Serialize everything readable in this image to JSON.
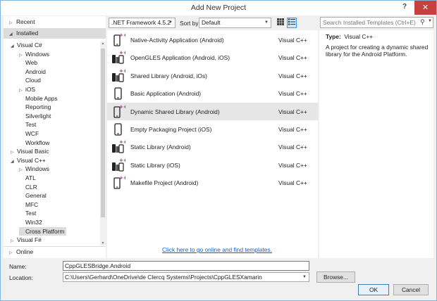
{
  "window": {
    "title": "Add New Project",
    "help_label": "?",
    "close_label": "✕"
  },
  "left": {
    "recent": "Recent",
    "installed": "Installed",
    "online": "Online",
    "tree": [
      {
        "label": "Visual C#",
        "arrow": "◢",
        "indent": 0
      },
      {
        "label": "Windows",
        "arrow": "▷",
        "indent": 1
      },
      {
        "label": "Web",
        "arrow": "",
        "indent": 1
      },
      {
        "label": "Android",
        "arrow": "",
        "indent": 1
      },
      {
        "label": "Cloud",
        "arrow": "",
        "indent": 1
      },
      {
        "label": "iOS",
        "arrow": "▷",
        "indent": 1
      },
      {
        "label": "Mobile Apps",
        "arrow": "",
        "indent": 1
      },
      {
        "label": "Reporting",
        "arrow": "",
        "indent": 1
      },
      {
        "label": "Silverlight",
        "arrow": "",
        "indent": 1
      },
      {
        "label": "Test",
        "arrow": "",
        "indent": 1
      },
      {
        "label": "WCF",
        "arrow": "",
        "indent": 1
      },
      {
        "label": "Workflow",
        "arrow": "",
        "indent": 1
      },
      {
        "label": "Visual Basic",
        "arrow": "▷",
        "indent": 0
      },
      {
        "label": "Visual C++",
        "arrow": "◢",
        "indent": 0
      },
      {
        "label": "Windows",
        "arrow": "▷",
        "indent": 1
      },
      {
        "label": "ATL",
        "arrow": "",
        "indent": 1
      },
      {
        "label": "CLR",
        "arrow": "",
        "indent": 1
      },
      {
        "label": "General",
        "arrow": "",
        "indent": 1
      },
      {
        "label": "MFC",
        "arrow": "",
        "indent": 1
      },
      {
        "label": "Test",
        "arrow": "",
        "indent": 1
      },
      {
        "label": "Win32",
        "arrow": "",
        "indent": 1
      },
      {
        "label": "Cross Platform",
        "arrow": "",
        "indent": 1,
        "selected": true
      },
      {
        "label": "Visual F#",
        "arrow": "▷",
        "indent": 0
      }
    ]
  },
  "toolbar": {
    "framework": ".NET Framework 4.5.2",
    "sort_label": "Sort by:",
    "sort_value": "Default",
    "search_placeholder": "Search Installed Templates (Ctrl+E)"
  },
  "templates": [
    {
      "name": "Native-Activity Application (Android)",
      "lang": "Visual C++",
      "icon": "phone-cpp"
    },
    {
      "name": "OpenGLES Application (Android, iOS)",
      "lang": "Visual C++",
      "icon": "multi-cpp"
    },
    {
      "name": "Shared Library (Android, iOs)",
      "lang": "Visual C++",
      "icon": "multi-cpp"
    },
    {
      "name": "Basic Application (Android)",
      "lang": "Visual C++",
      "icon": "phone"
    },
    {
      "name": "Dynamic Shared Library (Android)",
      "lang": "Visual C++",
      "icon": "phone-cpp",
      "selected": true
    },
    {
      "name": "Empty Packaging Project (iOS)",
      "lang": "Visual C++",
      "icon": "phone"
    },
    {
      "name": "Static Library (Android)",
      "lang": "Visual C++",
      "icon": "multi-cpp"
    },
    {
      "name": "Static Library (iOS)",
      "lang": "Visual C++",
      "icon": "multi-cpp"
    },
    {
      "name": "Makefile Project (Android)",
      "lang": "Visual C++",
      "icon": "phone-cpp"
    }
  ],
  "online_link": "Click here to go online and find templates.",
  "details": {
    "type_label": "Type:",
    "type_value": "Visual C++",
    "description": "A project for creating a dynamic shared library for the Android Platform."
  },
  "form": {
    "name_label": "Name:",
    "name_value": "CppGLESBridge.Android",
    "location_label": "Location:",
    "location_value": "C:\\Users\\Gerhard\\OneDrive\\de Clercq Systems\\Projects\\CppGLESXamarin",
    "browse_label": "Browse...",
    "ok_label": "OK",
    "cancel_label": "Cancel"
  },
  "colors": {
    "accent": "#3399ff",
    "cpp_plus": "#a0208f",
    "close": "#c74040",
    "link": "#1a5fc4"
  }
}
